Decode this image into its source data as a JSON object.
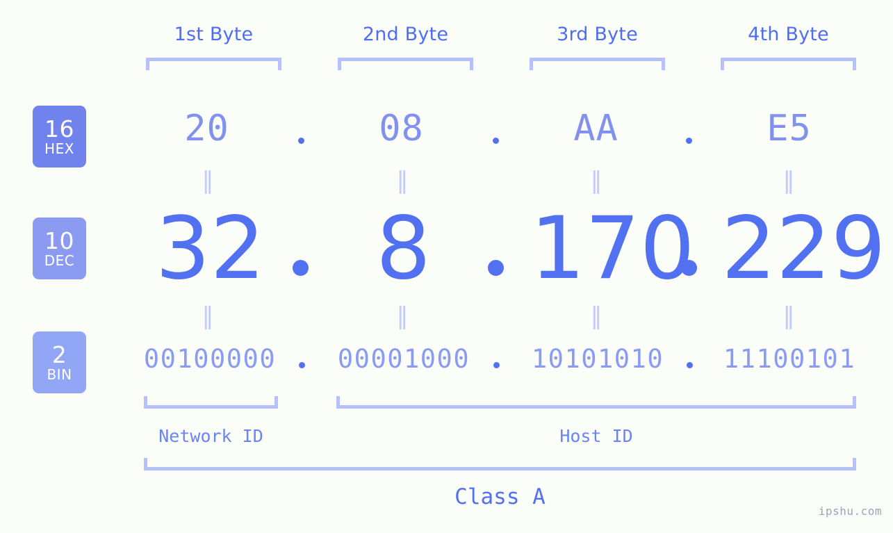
{
  "site": {
    "watermark": "ipshu.com"
  },
  "headers": [
    {
      "label": "1st Byte"
    },
    {
      "label": "2nd Byte"
    },
    {
      "label": "3rd Byte"
    },
    {
      "label": "4th Byte"
    }
  ],
  "bases": [
    {
      "number": "16",
      "name": "HEX",
      "color": "#7082ec"
    },
    {
      "number": "10",
      "name": "DEC",
      "color": "#8b9bf2"
    },
    {
      "number": "2",
      "name": "BIN",
      "color": "#92a6f6"
    }
  ],
  "rows": {
    "hex": {
      "values": [
        "20",
        "08",
        "AA",
        "E5"
      ],
      "separator": "."
    },
    "dec": {
      "values": [
        "32",
        "8",
        "170",
        "229"
      ],
      "separator": "."
    },
    "bin": {
      "values": [
        "00100000",
        "00001000",
        "10101010",
        "11100101"
      ],
      "separator": "."
    }
  },
  "equals_mark": "‖",
  "segments": [
    {
      "label": "Network ID"
    },
    {
      "label": "Host ID"
    }
  ],
  "class": {
    "label": "Class A"
  },
  "colors": {
    "background": "#fbfdf8",
    "accent": "#5271f0",
    "accent_light": "#8291ee",
    "bracket": "#b6c0fb",
    "header_text": "#4e6ef2",
    "equals": "#c3ccfc",
    "watermark": "#9aa6b8"
  }
}
